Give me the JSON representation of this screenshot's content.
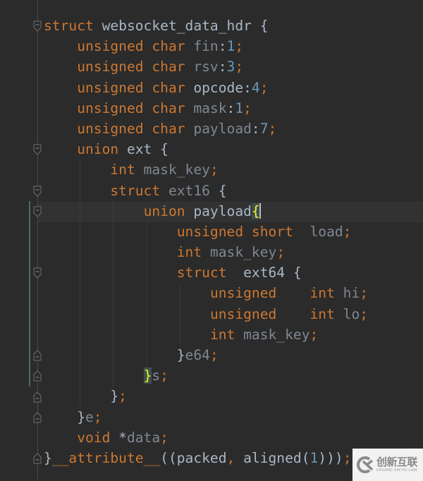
{
  "editor": {
    "theme_colors": {
      "background": "#2b2b2b",
      "keyword": "#cc7832",
      "identifier": "#a9b7c6",
      "field": "#7f8791",
      "number": "#6897bb",
      "bracket_match": "#ffef28"
    },
    "lines": [
      [
        {
          "t": "struct",
          "c": "kw"
        },
        {
          "t": " websocket_data_hdr ",
          "c": "ty"
        },
        {
          "t": "{",
          "c": "br"
        }
      ],
      [
        {
          "t": "    "
        },
        {
          "t": "unsigned char",
          "c": "kw"
        },
        {
          "t": " fin",
          "c": "fd"
        },
        {
          "t": ":",
          "c": "ty"
        },
        {
          "t": "1",
          "c": "num"
        },
        {
          "t": ";",
          "c": "pn"
        }
      ],
      [
        {
          "t": "    "
        },
        {
          "t": "unsigned char",
          "c": "kw"
        },
        {
          "t": " rsv",
          "c": "fd"
        },
        {
          "t": ":",
          "c": "ty"
        },
        {
          "t": "3",
          "c": "num"
        },
        {
          "t": ";",
          "c": "pn"
        }
      ],
      [
        {
          "t": "    "
        },
        {
          "t": "unsigned char",
          "c": "kw"
        },
        {
          "t": " opcode",
          "c": "fd2"
        },
        {
          "t": ":",
          "c": "ty"
        },
        {
          "t": "4",
          "c": "num"
        },
        {
          "t": ";",
          "c": "pn"
        }
      ],
      [
        {
          "t": "    "
        },
        {
          "t": "unsigned char",
          "c": "kw"
        },
        {
          "t": " mask",
          "c": "fd"
        },
        {
          "t": ":",
          "c": "ty"
        },
        {
          "t": "1",
          "c": "num"
        },
        {
          "t": ";",
          "c": "pn"
        }
      ],
      [
        {
          "t": "    "
        },
        {
          "t": "unsigned char",
          "c": "kw"
        },
        {
          "t": " payload",
          "c": "fd"
        },
        {
          "t": ":",
          "c": "ty"
        },
        {
          "t": "7",
          "c": "num"
        },
        {
          "t": ";",
          "c": "pn"
        }
      ],
      [
        {
          "t": "    "
        },
        {
          "t": "union",
          "c": "kw"
        },
        {
          "t": " ext ",
          "c": "ty"
        },
        {
          "t": "{",
          "c": "br"
        }
      ],
      [
        {
          "t": "        "
        },
        {
          "t": "int",
          "c": "kw"
        },
        {
          "t": " mask_key",
          "c": "fd"
        },
        {
          "t": ";",
          "c": "pn"
        }
      ],
      [
        {
          "t": "        "
        },
        {
          "t": "struct",
          "c": "kw"
        },
        {
          "t": " ext16 ",
          "c": "fd"
        },
        {
          "t": "{",
          "c": "br"
        }
      ],
      [
        {
          "t": "            "
        },
        {
          "t": "union",
          "c": "kw"
        },
        {
          "t": " payload",
          "c": "ty"
        },
        {
          "t": "{",
          "c": "brm"
        },
        {
          "t": "",
          "c": "caret"
        }
      ],
      [
        {
          "t": "                "
        },
        {
          "t": "unsigned short",
          "c": "kw"
        },
        {
          "t": "  load",
          "c": "fd"
        },
        {
          "t": ";",
          "c": "pn"
        }
      ],
      [
        {
          "t": "                "
        },
        {
          "t": "int",
          "c": "kw"
        },
        {
          "t": " mask_key",
          "c": "fd"
        },
        {
          "t": ";",
          "c": "pn"
        }
      ],
      [
        {
          "t": "                "
        },
        {
          "t": "struct",
          "c": "kw"
        },
        {
          "t": "  ext64 ",
          "c": "ty"
        },
        {
          "t": "{",
          "c": "br"
        }
      ],
      [
        {
          "t": "                    "
        },
        {
          "t": "unsigned",
          "c": "kw"
        },
        {
          "t": "    "
        },
        {
          "t": "int",
          "c": "kw"
        },
        {
          "t": " hi",
          "c": "fd"
        },
        {
          "t": ";",
          "c": "pn"
        }
      ],
      [
        {
          "t": "                    "
        },
        {
          "t": "unsigned",
          "c": "kw"
        },
        {
          "t": "    "
        },
        {
          "t": "int",
          "c": "kw"
        },
        {
          "t": " lo",
          "c": "fd"
        },
        {
          "t": ";",
          "c": "pn"
        }
      ],
      [
        {
          "t": "                    "
        },
        {
          "t": "int",
          "c": "kw"
        },
        {
          "t": " mask_key",
          "c": "fd"
        },
        {
          "t": ";",
          "c": "pn"
        }
      ],
      [
        {
          "t": "                "
        },
        {
          "t": "}",
          "c": "br"
        },
        {
          "t": "e64",
          "c": "fd"
        },
        {
          "t": ";",
          "c": "pn"
        }
      ],
      [
        {
          "t": "            "
        },
        {
          "t": "}",
          "c": "brm"
        },
        {
          "t": "s",
          "c": "fd"
        },
        {
          "t": ";",
          "c": "pn"
        }
      ],
      [
        {
          "t": "        "
        },
        {
          "t": "}",
          "c": "br"
        },
        {
          "t": ";",
          "c": "pn"
        }
      ],
      [
        {
          "t": "    "
        },
        {
          "t": "}",
          "c": "br"
        },
        {
          "t": "e",
          "c": "fd"
        },
        {
          "t": ";",
          "c": "pn"
        }
      ],
      [
        {
          "t": "    "
        },
        {
          "t": "void",
          "c": "kw"
        },
        {
          "t": " *",
          "c": "ty"
        },
        {
          "t": "data",
          "c": "fd"
        },
        {
          "t": ";",
          "c": "pn"
        }
      ],
      [
        {
          "t": "}",
          "c": "br"
        },
        {
          "t": "__attribute__",
          "c": "kw"
        },
        {
          "t": "((packed",
          "c": "ty"
        },
        {
          "t": ",",
          "c": "pn"
        },
        {
          "t": " aligned(",
          "c": "ty"
        },
        {
          "t": "1",
          "c": "num"
        },
        {
          "t": ")))",
          "c": "ty"
        },
        {
          "t": ";",
          "c": "pn"
        }
      ]
    ],
    "fold_markers": [
      {
        "line": 1,
        "type": "start"
      },
      {
        "line": 7,
        "type": "start"
      },
      {
        "line": 9,
        "type": "start"
      },
      {
        "line": 10,
        "type": "start"
      },
      {
        "line": 13,
        "type": "start"
      },
      {
        "line": 17,
        "type": "end"
      },
      {
        "line": 18,
        "type": "end"
      },
      {
        "line": 19,
        "type": "end"
      },
      {
        "line": 20,
        "type": "end"
      },
      {
        "line": 22,
        "type": "end"
      }
    ],
    "caret_line": 10
  },
  "watermark": {
    "icon": "chuangxin-logo-icon",
    "text_cn": "创新互联",
    "text_en": "CHUANG XIN HU LIAN"
  }
}
